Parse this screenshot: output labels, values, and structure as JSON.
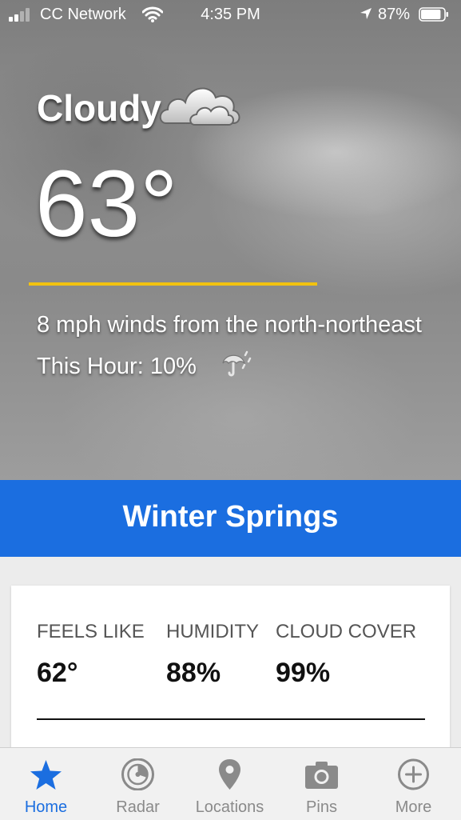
{
  "status_bar": {
    "carrier": "CC Network",
    "time": "4:35 PM",
    "battery_percent": "87%",
    "battery_level": 0.87,
    "signal_bars_filled": 2,
    "signal_bars_total": 4
  },
  "current": {
    "condition": "Cloudy",
    "condition_icon": "cloud-icon",
    "temperature": "63°",
    "wind": "8 mph winds from the north-northeast",
    "precip_label": "This Hour: 10%",
    "precip_icon": "umbrella-rain-icon"
  },
  "location": {
    "name": "Winter Springs"
  },
  "details": [
    {
      "label": "FEELS LIKE",
      "value": "62°"
    },
    {
      "label": "HUMIDITY",
      "value": "88%"
    },
    {
      "label": "CLOUD COVER",
      "value": "99%"
    }
  ],
  "tabs": [
    {
      "label": "Home",
      "icon": "star-icon",
      "active": true
    },
    {
      "label": "Radar",
      "icon": "radar-icon",
      "active": false
    },
    {
      "label": "Locations",
      "icon": "map-pin-icon",
      "active": false
    },
    {
      "label": "Pins",
      "icon": "camera-icon",
      "active": false
    },
    {
      "label": "More",
      "icon": "plus-circle-icon",
      "active": false
    }
  ],
  "colors": {
    "accent": "#1b6ee0",
    "divider": "#f2c20f",
    "tab_inactive": "#8a8a8a"
  }
}
